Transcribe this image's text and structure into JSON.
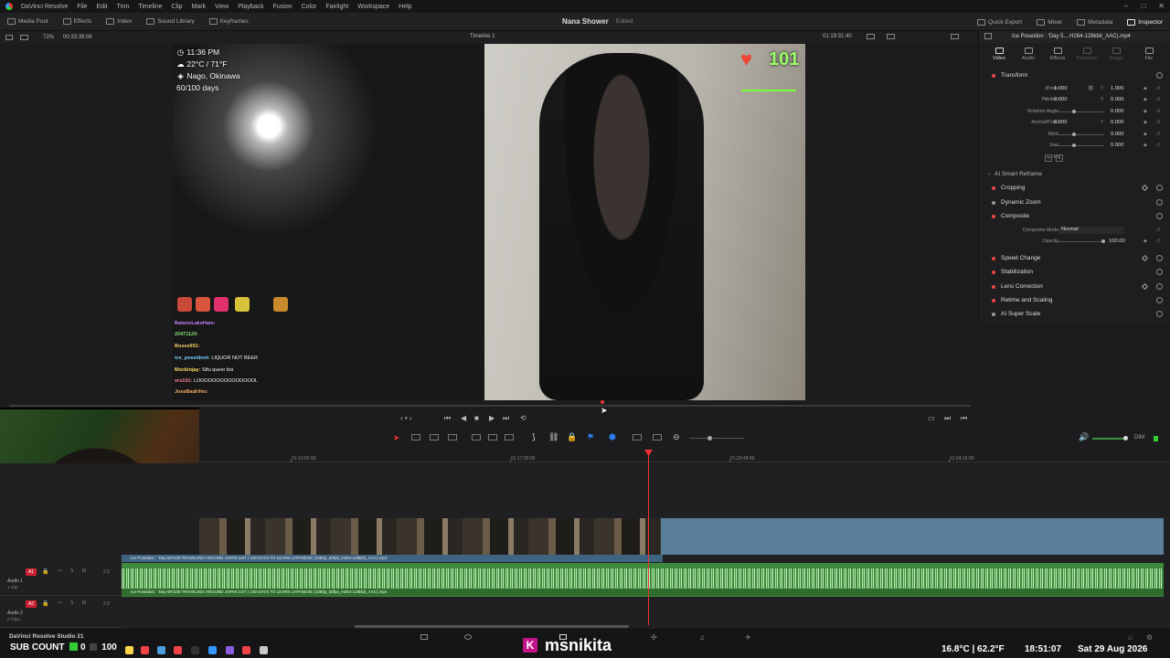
{
  "menubar": {
    "app_name": "DaVinci Resolve",
    "items": [
      "File",
      "Edit",
      "Trim",
      "Timeline",
      "Clip",
      "Mark",
      "View",
      "Playback",
      "Fusion",
      "Color",
      "Fairlight",
      "Workspace",
      "Help"
    ]
  },
  "toolbar": {
    "left": [
      {
        "label": "Media Pool",
        "icon": "media-pool-icon"
      },
      {
        "label": "Effects",
        "icon": "effects-icon"
      },
      {
        "label": "Index",
        "icon": "index-icon"
      },
      {
        "label": "Sound Library",
        "icon": "sound-library-icon"
      },
      {
        "label": "Keyframes",
        "icon": "keyframes-icon"
      }
    ],
    "project_title": "Nana Shower",
    "project_status": "Edited",
    "right": [
      {
        "label": "Quick Export",
        "icon": "export-icon"
      },
      {
        "label": "Mixer",
        "icon": "mixer-icon"
      },
      {
        "label": "Metadata",
        "icon": "metadata-icon"
      },
      {
        "label": "Inspector",
        "icon": "inspector-icon"
      }
    ]
  },
  "viewer_bar": {
    "zoom": "72%",
    "source_timecode": "00:33:39:06",
    "timeline_name": "Timeline 1",
    "timecode": "01:19:31:40"
  },
  "viewer_overlay": {
    "time": "11:36 PM",
    "weather": "22°C / 71°F",
    "location": "Nago, Okinawa",
    "days": "60/100 days",
    "heart_count": "101",
    "chat": [
      {
        "user": "BalanoLakeHam:",
        "msg": ""
      },
      {
        "user": "20471120:",
        "msg": ""
      },
      {
        "user": "Bosse991:",
        "msg": ""
      },
      {
        "user": "ice_poseidont:",
        "msg": "LIQUOR NOT BEER"
      },
      {
        "user": "Mockinjay:",
        "msg": "Stfu queer boi"
      },
      {
        "user": "vrx101:",
        "msg": "LOOOOOOOOOOOOOOOL"
      },
      {
        "user": "JoseBadrihio:",
        "msg": ""
      }
    ]
  },
  "inspector": {
    "title": "Ice Poseidon : 'Day 5....H264-128kbit_AAC).mp4",
    "tabs": [
      {
        "label": "Video",
        "icon": "video-icon"
      },
      {
        "label": "Audio",
        "icon": "audio-icon"
      },
      {
        "label": "Effects",
        "icon": "effects-icon"
      },
      {
        "label": "Transition",
        "icon": "transition-icon"
      },
      {
        "label": "Image",
        "icon": "image-icon"
      },
      {
        "label": "File",
        "icon": "file-icon"
      }
    ],
    "transform_label": "Transform",
    "zoom": {
      "label": "Zoom",
      "x": "1.000",
      "y": "1.000"
    },
    "position": {
      "label": "Position",
      "x": "0.000",
      "y": "0.000"
    },
    "rotation": {
      "label": "Rotation Angle",
      "value": "0.000"
    },
    "anchor": {
      "label": "Anchor Point",
      "x": "0.000",
      "y": "0.000"
    },
    "pitch": {
      "label": "Pitch",
      "value": "0.000"
    },
    "yaw": {
      "label": "Yaw",
      "value": "0.000"
    },
    "flip_label": "Flip",
    "ai_reframe": "AI Smart Reframe",
    "cropping": "Cropping",
    "dynamic_zoom": "Dynamic Zoom",
    "composite": "Composite",
    "composite_mode_label": "Composite Mode",
    "composite_mode": "Normal",
    "opacity_label": "Opacity",
    "opacity": "100.00",
    "speed_change": "Speed Change",
    "stabilization": "Stabilization",
    "lens_correction": "Lens Correction",
    "retime": "Retime and Scaling",
    "super_scale": "AI Super Scale"
  },
  "timeline": {
    "ruler": [
      "01:13:52:00",
      "01:17:20:00",
      "01:20:48:00",
      "01:24:16:00"
    ],
    "video_clip": "Ice Poseidon : 'Day 59'/100 TRAVELING AROUND JAPAN 24/7 | 100 DAYS TO LEARN JAPANESE (1080p_60fps_H264-128kbit_AAC).mp4",
    "audio_clip": "Ice Poseidon : 'Day 59'/100 TRAVELING AROUND JAPAN 24/7 | 100 DAYS TO LEARN JAPANESE (1080p_60fps_H264-128kbit_AAC).mp4",
    "tracks": [
      {
        "tag": "A1",
        "name": "Audio 1",
        "sub": "1 Clip",
        "vol": "2.0"
      },
      {
        "tag": "A2",
        "name": "Audio 2",
        "sub": "0 Clips",
        "vol": "2.0"
      }
    ]
  },
  "status": {
    "resolve_label": "DaVinci Resolve Studio 21",
    "sub_count_label": "SUB COUNT",
    "sub_count": "0",
    "sub_goal": "100",
    "overlay_name": "msnikita",
    "overlay_k": "K",
    "temperature": "16.8°C | 62.2°F",
    "clock": "18:51:07",
    "date": "Sat 29 Aug 2026"
  },
  "dim_label": "DIM"
}
